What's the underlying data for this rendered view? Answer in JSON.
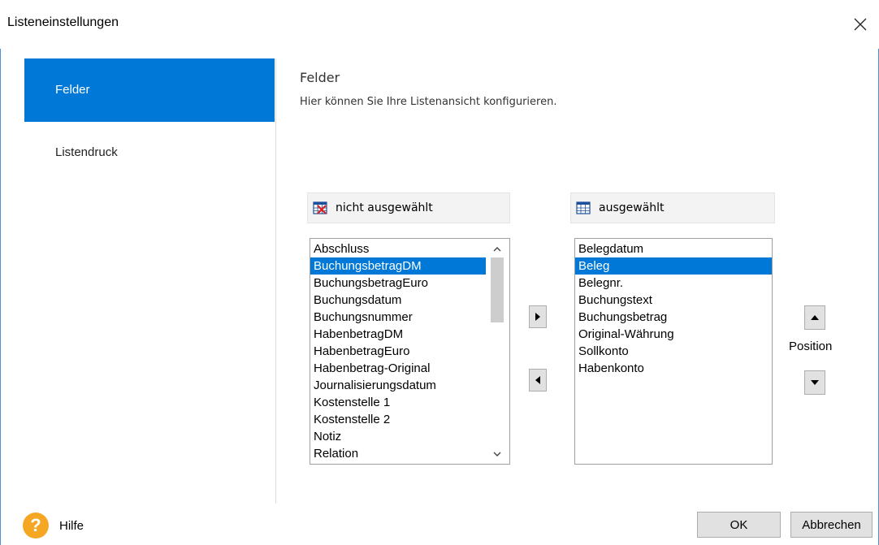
{
  "window": {
    "title": "Listeneinstellungen",
    "close_icon": "close-icon"
  },
  "nav": {
    "items": [
      {
        "label": "Felder",
        "active": true
      },
      {
        "label": "Listendruck",
        "active": false
      }
    ]
  },
  "section": {
    "title": "Felder",
    "description": "Hier können Sie Ihre Listenansicht konfigurieren."
  },
  "available": {
    "header": "nicht ausgewählt",
    "icon": "table-remove-icon",
    "items": [
      "Abschluss",
      "BuchungsbetragDM",
      "BuchungsbetragEuro",
      "Buchungsdatum",
      "Buchungsnummer",
      "HabenbetragDM",
      "HabenbetragEuro",
      "Habenbetrag-Original",
      "Journalisierungsdatum",
      "Kostenstelle 1",
      "Kostenstelle 2",
      "Notiz",
      "Relation"
    ],
    "selected_index": 1
  },
  "selected": {
    "header": "ausgewählt",
    "icon": "table-icon",
    "items": [
      "Belegdatum",
      "Beleg",
      "Belegnr.",
      "Buchungstext",
      "Buchungsbetrag",
      "Original-Währung",
      "Sollkonto",
      "Habenkonto"
    ],
    "selected_index": 1
  },
  "position_label": "Position",
  "footer": {
    "help_label": "Hilfe",
    "ok_label": "OK",
    "cancel_label": "Abbrechen"
  },
  "colors": {
    "accent": "#0078d7",
    "help": "#f5a623",
    "button_bg": "#e1e1e1"
  }
}
